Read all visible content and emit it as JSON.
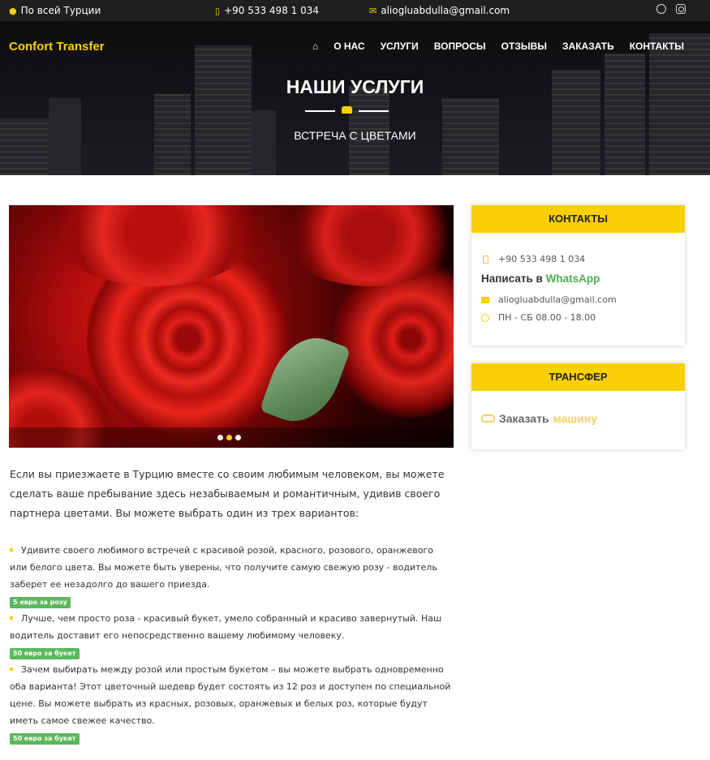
{
  "topbar": {
    "location": "По всей Турции",
    "phone": "+90 533 498 1 034",
    "email": "aliogluabdulla@gmail.com"
  },
  "header": {
    "brand": "Confort Transfer",
    "nav": [
      "О НАС",
      "УСЛУГИ",
      "ВОПРОСЫ",
      "ОТЗЫВЫ",
      "ЗАКАЗАТЬ",
      "КОНТАКТЫ"
    ]
  },
  "hero": {
    "title": "НАШИ УСЛУГИ",
    "subtitle": "ВСТРЕЧА С ЦВЕТАМИ"
  },
  "slider": {
    "active_slide": 2,
    "slide_count": 3
  },
  "main": {
    "intro": "Если вы приезжаете в Турцию вместе со своим любимым человеком, вы можете сделать ваше пребывание здесь незабываемым и романтичным, удивив своего партнера цветами. Вы можете выбрать один из трех вариантов:",
    "offers": [
      {
        "text": "Удивите своего любимого встречей с красивой розой, красного, розового, оранжевого или белого цвета. Вы можете быть уверены, что получите самую свежую розу - водитель заберет ее незадолго до вашего приезда.",
        "price": "5 евро за розу"
      },
      {
        "text": "Лучше, чем просто роза - красивый букет, умело собранный и красиво завернутый. Наш водитель доставит его непосредственно вашему любимому человеку.",
        "price": "50 евро за букет"
      },
      {
        "text": "Зачем выбирать между розой или простым букетом – вы можете выбрать одновременно оба варианта! Этот цветочный шедевр будет состоять из 12 роз и доступен по специальной цене. Вы можете выбрать из красных, розовых, оранжевых и белых роз, которые будут иметь самое свежее качество.",
        "price": "50 евро за букет"
      }
    ]
  },
  "sidebar": {
    "contacts": {
      "title": "КОНТАКТЫ",
      "phone": "+90 533 498 1 034",
      "whatsapp_prefix": "Написать в",
      "whatsapp_word": "WhatsApp",
      "email": "aliogluabdulla@gmail.com",
      "hours": "ПН - СБ 08.00 - 18.00"
    },
    "transfer": {
      "title": "ТРАНСФЕР",
      "order_prefix": "Заказать",
      "order_word": "машину"
    }
  },
  "colors": {
    "accent": "#f9cf05",
    "badge": "#5cb85c",
    "whatsapp": "#4caf50",
    "dark": "#1f1f1f"
  }
}
